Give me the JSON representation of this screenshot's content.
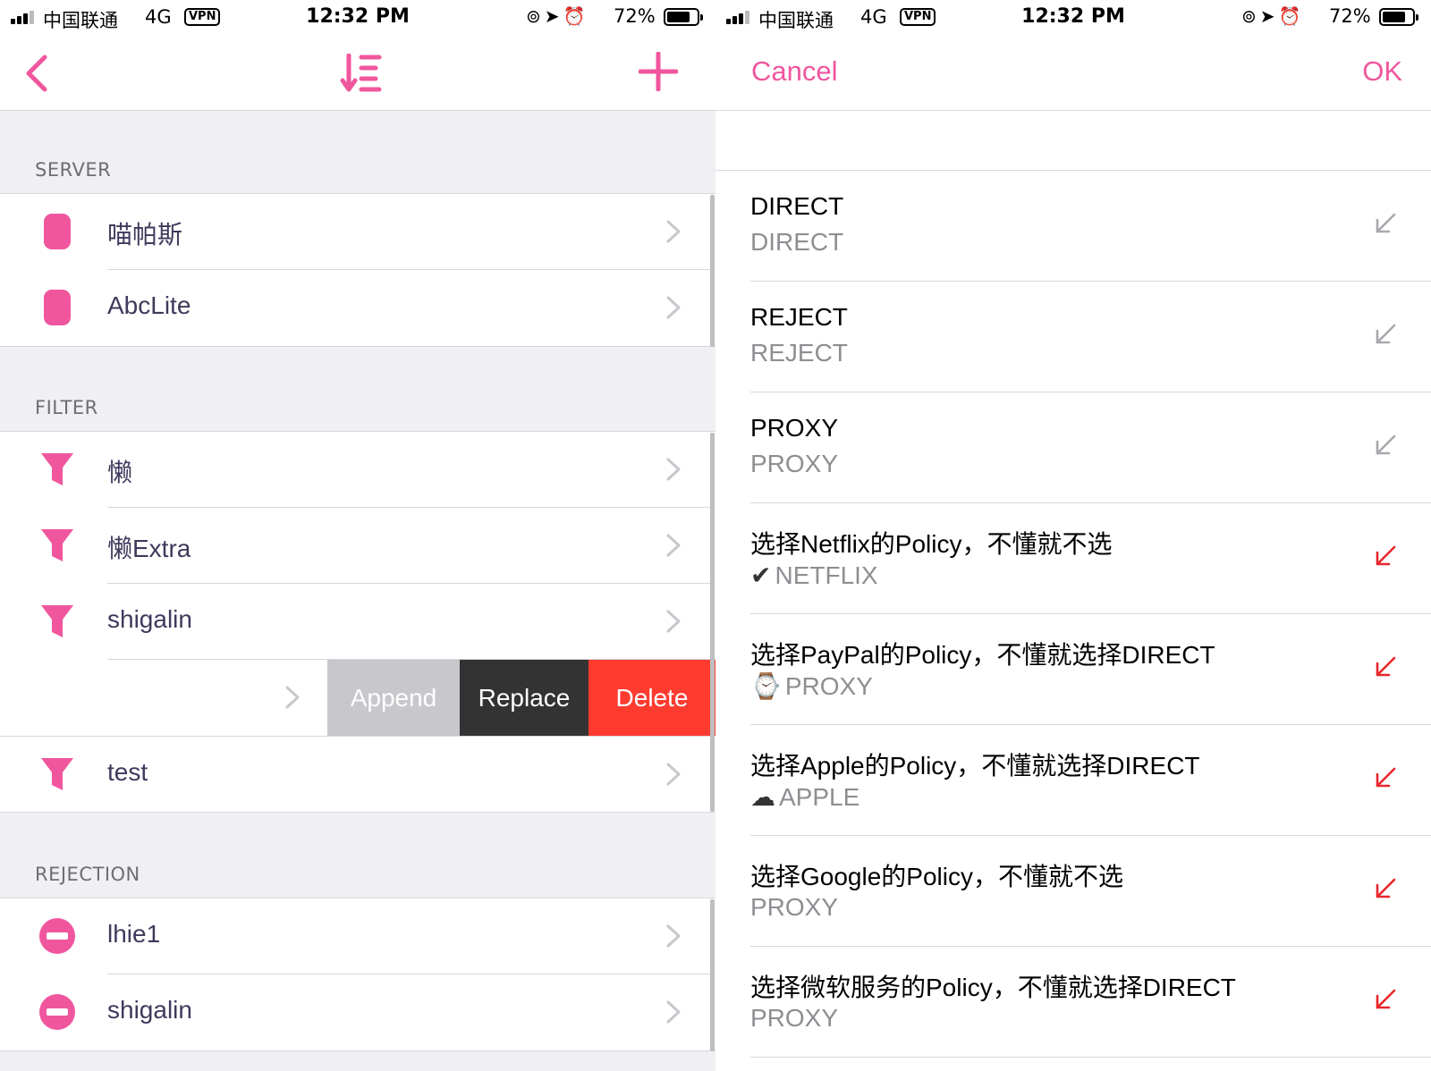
{
  "status_bar": {
    "carrier": "中国联通",
    "network": "4G",
    "vpn": "VPN",
    "time": "12:32 PM",
    "battery": "72%"
  },
  "left": {
    "sections": [
      {
        "header": "SERVER",
        "icon": "server-icon",
        "items": [
          "喵帕斯",
          "AbcLite"
        ]
      },
      {
        "header": "FILTER",
        "icon": "filter-icon",
        "items": [
          "懒",
          "懒Extra",
          "shigalin",
          "",
          "test"
        ]
      },
      {
        "header": "REJECTION",
        "icon": "reject-icon",
        "items": [
          "lhie1",
          "shigalin"
        ]
      }
    ],
    "swipe_actions": {
      "append": "Append",
      "replace": "Replace",
      "delete": "Delete"
    }
  },
  "right": {
    "nav": {
      "cancel": "Cancel",
      "ok": "OK"
    },
    "policies": [
      {
        "title": "DIRECT",
        "value": "DIRECT",
        "emoji": "",
        "active": false
      },
      {
        "title": "REJECT",
        "value": "REJECT",
        "emoji": "",
        "active": false
      },
      {
        "title": "PROXY",
        "value": "PROXY",
        "emoji": "",
        "active": false
      },
      {
        "title": "选择Netflix的Policy，不懂就不选",
        "value": "NETFLIX",
        "emoji": "✔",
        "active": true
      },
      {
        "title": "选择PayPal的Policy，不懂就选择DIRECT",
        "value": "PROXY",
        "emoji": "⌚",
        "active": true
      },
      {
        "title": "选择Apple的Policy，不懂就选择DIRECT",
        "value": "APPLE",
        "emoji": "☁",
        "active": true
      },
      {
        "title": "选择Google的Policy，不懂就不选",
        "value": "PROXY",
        "emoji": "",
        "active": true
      },
      {
        "title": "选择微软服务的Policy，不懂就选择DIRECT",
        "value": "PROXY",
        "emoji": "",
        "active": true
      }
    ]
  },
  "colors": {
    "accent": "#f0569e",
    "delete": "#ff3b30",
    "replace": "#333333",
    "append": "#c8c7cc",
    "arrow_active": "#e8262b",
    "arrow_inactive": "#a8a8ad"
  }
}
